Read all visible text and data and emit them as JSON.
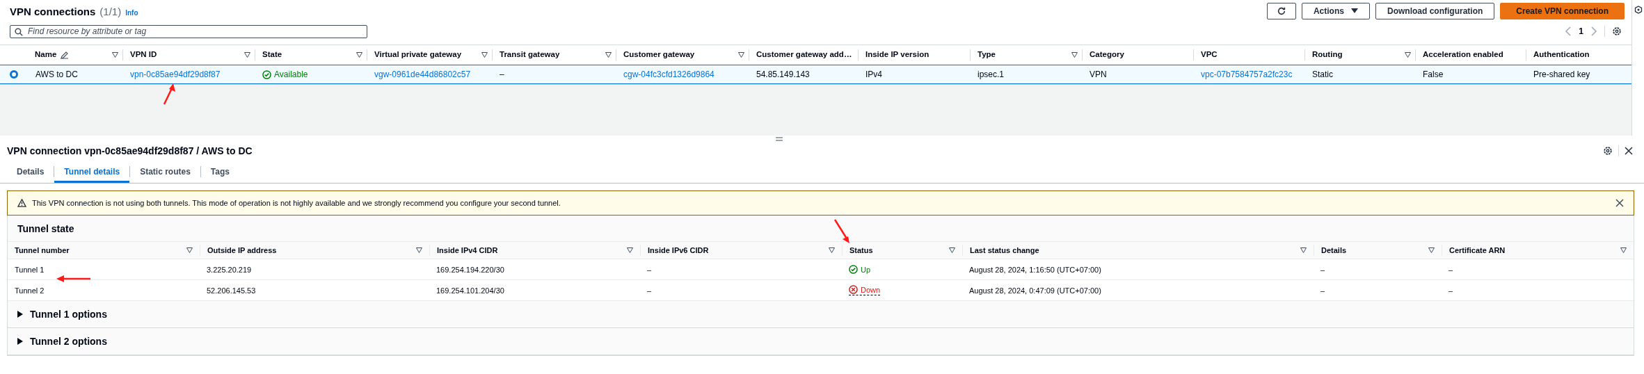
{
  "list": {
    "title": "VPN connections",
    "count": "(1/1)",
    "info": "Info",
    "search": {
      "placeholder": "Find resource by attribute or tag"
    },
    "actions": "Actions",
    "download": "Download configuration",
    "create": "Create VPN connection",
    "page": "1",
    "columns": [
      {
        "label": "Name",
        "filter": true,
        "editable": true
      },
      {
        "label": "VPN ID",
        "filter": true,
        "editable": false
      },
      {
        "label": "State",
        "filter": true,
        "editable": false
      },
      {
        "label": "Virtual private gateway",
        "filter": true,
        "editable": false
      },
      {
        "label": "Transit gateway",
        "filter": true,
        "editable": false
      },
      {
        "label": "Customer gateway",
        "filter": true,
        "editable": false
      },
      {
        "label": "Customer gateway add…",
        "filter": false,
        "editable": false
      },
      {
        "label": "Inside IP version",
        "filter": false,
        "editable": false
      },
      {
        "label": "Type",
        "filter": true,
        "editable": false
      },
      {
        "label": "Category",
        "filter": false,
        "editable": false
      },
      {
        "label": "VPC",
        "filter": false,
        "editable": false
      },
      {
        "label": "Routing",
        "filter": true,
        "editable": false
      },
      {
        "label": "Acceleration enabled",
        "filter": false,
        "editable": false
      },
      {
        "label": "Authentication",
        "filter": false,
        "editable": false
      }
    ],
    "rows": [
      {
        "selected": true,
        "cells": [
          {
            "text": "AWS to DC",
            "kind": "text"
          },
          {
            "text": "vpn-0c85ae94df29d8f87",
            "kind": "link"
          },
          {
            "text": "Available",
            "kind": "ok"
          },
          {
            "text": "vgw-0961de44d86802c57",
            "kind": "link"
          },
          {
            "text": "–",
            "kind": "text"
          },
          {
            "text": "cgw-04fc3cfd1326d9864",
            "kind": "link"
          },
          {
            "text": "54.85.149.143",
            "kind": "text"
          },
          {
            "text": "IPv4",
            "kind": "text"
          },
          {
            "text": "ipsec.1",
            "kind": "text"
          },
          {
            "text": "VPN",
            "kind": "text"
          },
          {
            "text": "vpc-07b7584757a2fc23c",
            "kind": "link"
          },
          {
            "text": "Static",
            "kind": "text"
          },
          {
            "text": "False",
            "kind": "text"
          },
          {
            "text": "Pre-shared key",
            "kind": "text"
          }
        ]
      }
    ]
  },
  "detail": {
    "title": "VPN connection vpn-0c85ae94df29d8f87 / AWS to DC",
    "tabs": [
      {
        "label": "Details",
        "selected": false
      },
      {
        "label": "Tunnel details",
        "selected": true
      },
      {
        "label": "Static routes",
        "selected": false
      },
      {
        "label": "Tags",
        "selected": false
      }
    ],
    "alert": "This VPN connection is not using both tunnels. This mode of operation is not highly available and we strongly recommend you configure your second tunnel.",
    "tunnel_state": {
      "title": "Tunnel state",
      "columns": [
        "Tunnel number",
        "Outside IP address",
        "Inside IPv4 CIDR",
        "Inside IPv6 CIDR",
        "Status",
        "Last status change",
        "Details",
        "Certificate ARN"
      ],
      "rows": [
        {
          "cells": [
            {
              "text": "Tunnel 1",
              "kind": "text"
            },
            {
              "text": "3.225.20.219",
              "kind": "text"
            },
            {
              "text": "169.254.194.220/30",
              "kind": "text"
            },
            {
              "text": "–",
              "kind": "text"
            },
            {
              "text": "Up",
              "kind": "ok"
            },
            {
              "text": "August 28, 2024, 1:16:50 (UTC+07:00)",
              "kind": "text"
            },
            {
              "text": "–",
              "kind": "text"
            },
            {
              "text": "–",
              "kind": "text"
            }
          ]
        },
        {
          "cells": [
            {
              "text": "Tunnel 2",
              "kind": "text"
            },
            {
              "text": "52.206.145.53",
              "kind": "text"
            },
            {
              "text": "169.254.101.204/30",
              "kind": "text"
            },
            {
              "text": "–",
              "kind": "text"
            },
            {
              "text": "Down",
              "kind": "error"
            },
            {
              "text": "August 28, 2024, 0:47:09 (UTC+07:00)",
              "kind": "text"
            },
            {
              "text": "–",
              "kind": "text"
            },
            {
              "text": "–",
              "kind": "text"
            }
          ]
        }
      ]
    },
    "sections": [
      {
        "title": "Tunnel 1 options",
        "expanded": false
      },
      {
        "title": "Tunnel 2 options",
        "expanded": false
      }
    ]
  }
}
